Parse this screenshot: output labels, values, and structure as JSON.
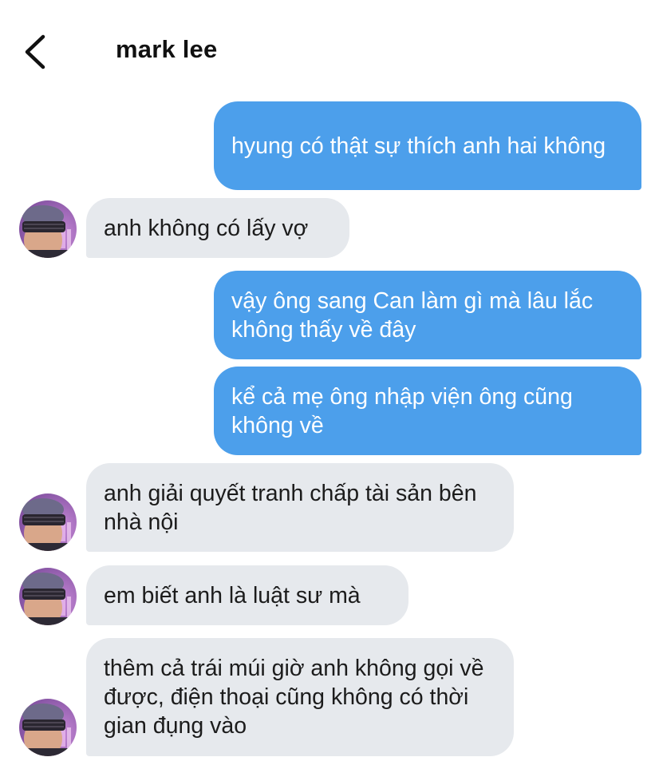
{
  "header": {
    "contact_name": "mark lee",
    "back_icon": "chevron-left-icon"
  },
  "messages": [
    {
      "direction": "outgoing",
      "text": "hyung có thật sự thích anh hai không"
    },
    {
      "direction": "incoming",
      "text": "anh không có lấy vợ"
    },
    {
      "direction": "outgoing",
      "text": "vậy ông sang Can làm gì mà lâu lắc không thấy về đây"
    },
    {
      "direction": "outgoing",
      "text": "kể cả mẹ ông nhập viện ông cũng không về"
    },
    {
      "direction": "incoming",
      "text": "anh giải quyết tranh chấp tài sản bên nhà nội"
    },
    {
      "direction": "incoming",
      "text": "em biết anh là luật sư mà"
    },
    {
      "direction": "incoming",
      "text": "thêm cả trái múi giờ anh không gọi về được, điện thoại cũng không có thời gian đụng vào"
    }
  ],
  "colors": {
    "outgoing_bubble": "#4c9feb",
    "incoming_bubble": "#e6e9ed",
    "outgoing_text": "#ffffff",
    "incoming_text": "#1c1c1c"
  }
}
